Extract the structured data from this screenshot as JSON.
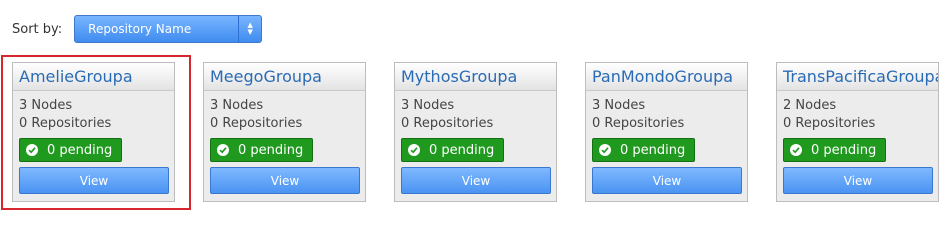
{
  "sort": {
    "label": "Sort by:",
    "selected": "Repository Name"
  },
  "cards": [
    {
      "name": "AmelieGroupa",
      "nodes": "3 Nodes",
      "repositories": "0 Repositories",
      "pending": "0 pending",
      "view_label": "View"
    },
    {
      "name": "MeegoGroupa",
      "nodes": "3 Nodes",
      "repositories": "0 Repositories",
      "pending": "0 pending",
      "view_label": "View"
    },
    {
      "name": "MythosGroupa",
      "nodes": "3 Nodes",
      "repositories": "0 Repositories",
      "pending": "0 pending",
      "view_label": "View"
    },
    {
      "name": "PanMondoGroupa",
      "nodes": "3 Nodes",
      "repositories": "0 Repositories",
      "pending": "0 pending",
      "view_label": "View"
    },
    {
      "name": "TransPacificaGroupa",
      "nodes": "2 Nodes",
      "repositories": "0 Repositories",
      "pending": "0 pending",
      "view_label": "View"
    }
  ],
  "colors": {
    "accent": "#4a93f2",
    "pending_green": "#1f9a1f",
    "selection_red": "#d7262e",
    "title_blue": "#2a6bb5"
  },
  "icons": {
    "pending": "check-circle-icon",
    "select": "sort-arrows-icon"
  }
}
